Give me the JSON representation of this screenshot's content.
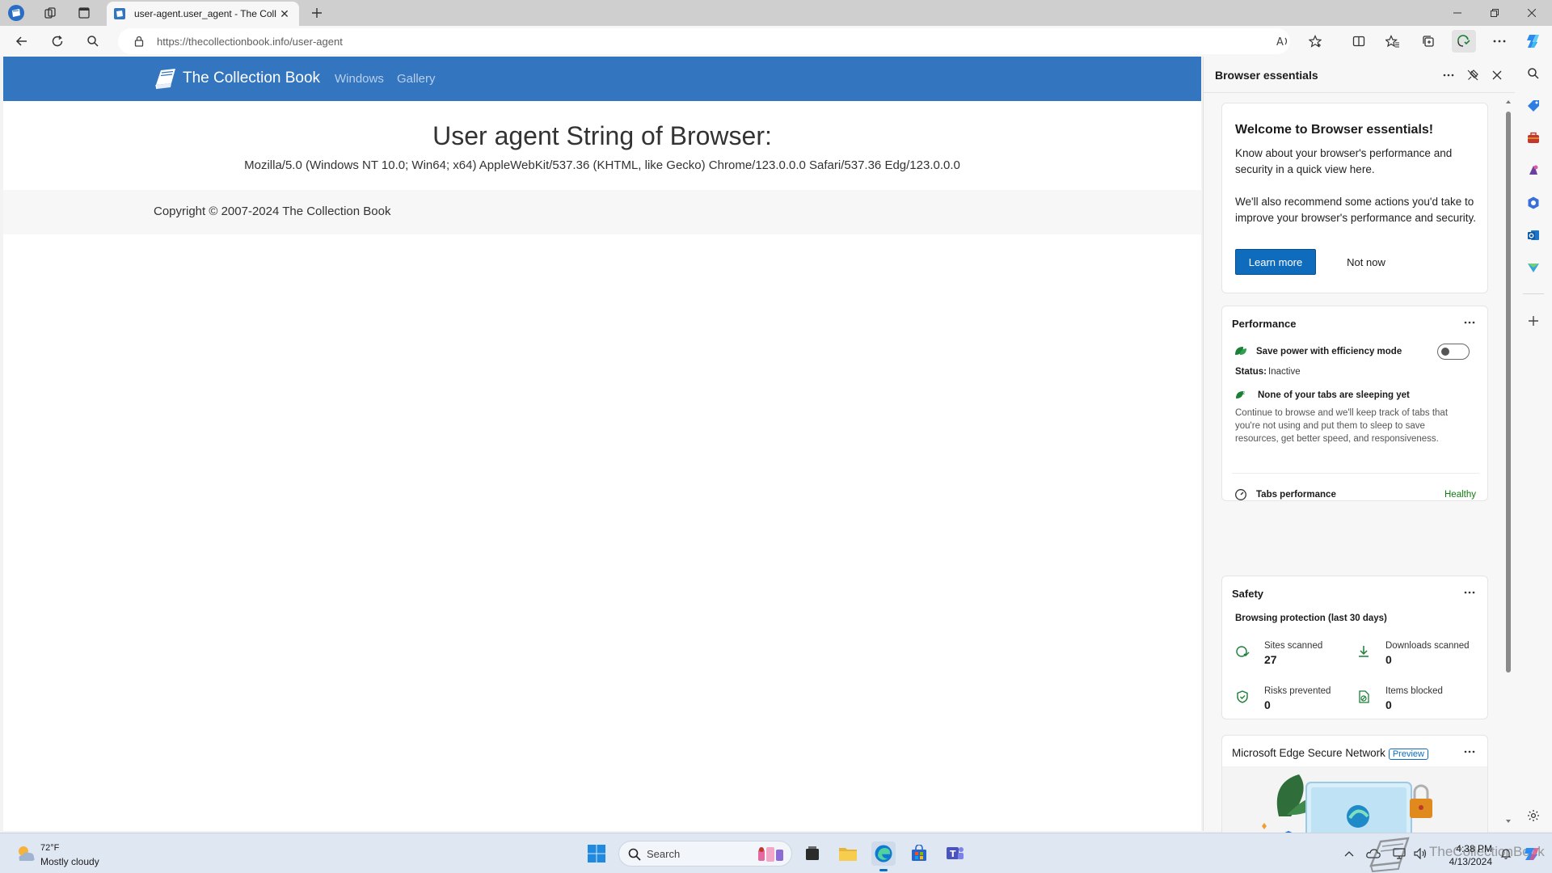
{
  "browser": {
    "tab_title": "user-agent.user_agent - The Coll",
    "address_url_host": "https://thecollectionbook.info",
    "address_url_path": "/user-agent"
  },
  "site": {
    "brand": "The Collection Book",
    "nav": [
      "Windows",
      "Gallery"
    ],
    "heading": "User agent String of Browser:",
    "user_agent": "Mozilla/5.0 (Windows NT 10.0; Win64; x64) AppleWebKit/537.36 (KHTML, like Gecko) Chrome/123.0.0.0 Safari/537.36 Edg/123.0.0.0",
    "copyright": "Copyright © 2007-2024 The Collection Book"
  },
  "pane": {
    "title": "Browser essentials",
    "welcome": {
      "title": "Welcome to Browser essentials!",
      "text1": "Know about your browser's performance and security in a quick view here.",
      "text2": "We'll also recommend some actions you'd take to improve your browser's performance and security.",
      "learn_more": "Learn more",
      "not_now": "Not now"
    },
    "performance": {
      "title": "Performance",
      "efficiency_label": "Save power with efficiency mode",
      "status_label": "Status:",
      "status_value": "Inactive",
      "efficiency_on": false,
      "sleeping_title": "None of your tabs are sleeping yet",
      "sleeping_text": "Continue to browse and we'll keep track of tabs that you're not using and put them to sleep to save resources, get better speed, and responsiveness.",
      "tabs_perf_label": "Tabs performance",
      "tabs_perf_value": "Healthy"
    },
    "safety": {
      "title": "Safety",
      "subtitle": "Browsing protection (last 30 days)",
      "stats": [
        {
          "label": "Sites scanned",
          "value": "27"
        },
        {
          "label": "Downloads scanned",
          "value": "0"
        },
        {
          "label": "Risks prevented",
          "value": "0"
        },
        {
          "label": "Items blocked",
          "value": "0"
        }
      ]
    },
    "secure_network": {
      "title": "Microsoft Edge Secure Network",
      "badge": "Preview"
    }
  },
  "taskbar": {
    "weather_temp": "72°F",
    "weather_cond": "Mostly cloudy",
    "search_placeholder": "Search",
    "time": "4:38 PM",
    "date": "4/13/2024",
    "watermark": "TheCollectionBook"
  },
  "colors": {
    "navbar": "#3375be",
    "accent": "#0f6cbd",
    "healthy": "#107c10"
  }
}
